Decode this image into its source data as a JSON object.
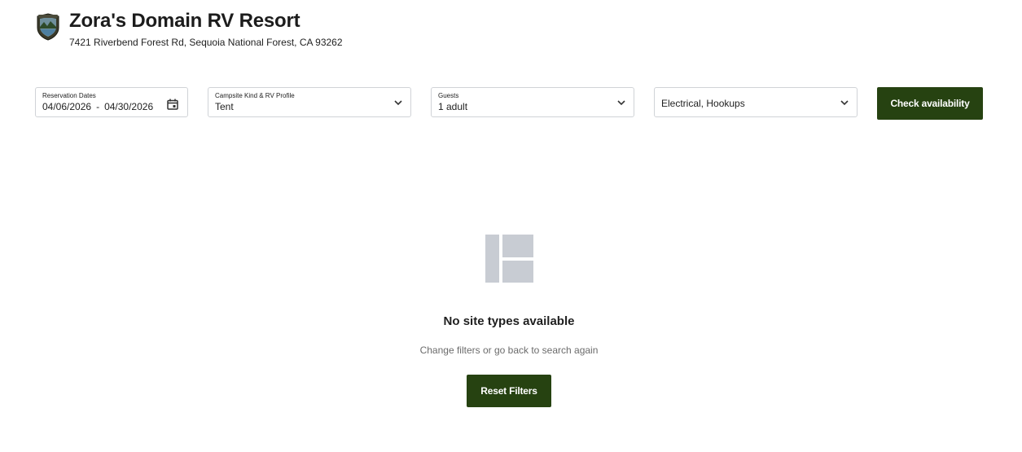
{
  "header": {
    "title": "Zora's Domain RV Resort",
    "address": "7421 Riverbend Forest Rd, Sequoia National Forest, CA 93262",
    "logo_icon": "resort-badge-icon"
  },
  "filters": {
    "dates": {
      "label": "Reservation Dates",
      "start": "04/06/2026",
      "separator": "-",
      "end": "04/30/2026",
      "icon": "calendar-icon"
    },
    "campsite_kind": {
      "label": "Campsite Kind & RV Profile",
      "value": "Tent",
      "icon": "chevron-down-icon"
    },
    "guests": {
      "label": "Guests",
      "value": "1 adult",
      "icon": "chevron-down-icon"
    },
    "amenities": {
      "value": "Electrical, Hookups",
      "icon": "chevron-down-icon"
    },
    "check_label": "Check availability"
  },
  "empty_state": {
    "icon": "layout-placeholder-icon",
    "title": "No site types available",
    "subtitle": "Change filters or go back to search again",
    "reset_label": "Reset Filters"
  },
  "colors": {
    "primary_button": "#264211",
    "placeholder_icon": "#c8ccd3",
    "field_border": "#d0d3d7"
  }
}
